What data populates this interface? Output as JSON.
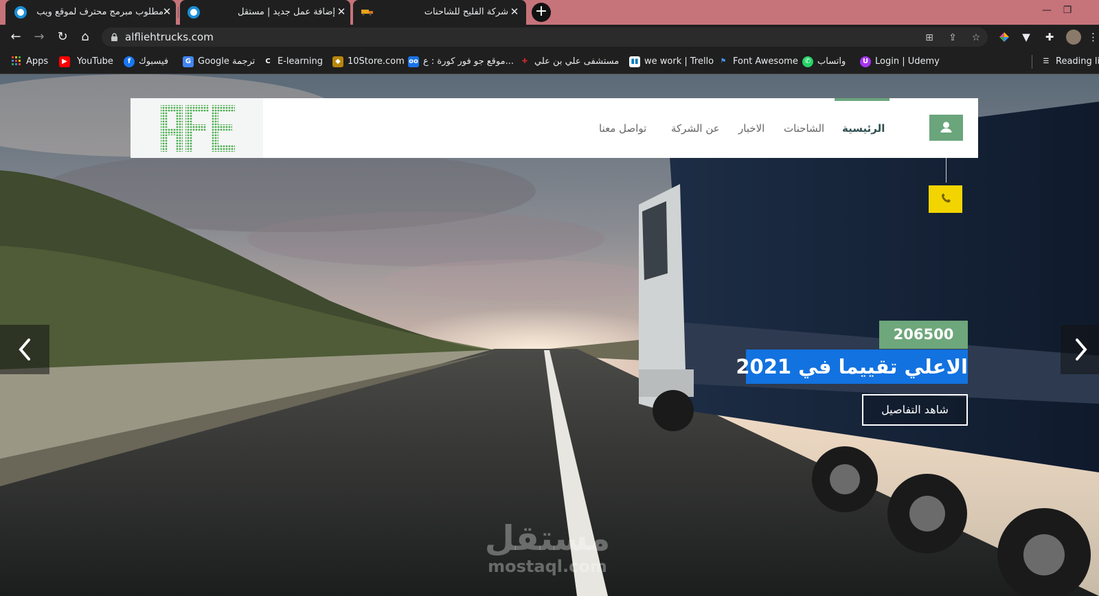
{
  "browser": {
    "tabs": [
      {
        "title": "مطلوب مبرمج محترف لموقع ويب |",
        "favicon": "ring-icon"
      },
      {
        "title": "إضافة عمل جديد | مستقل",
        "favicon": "ring-icon"
      },
      {
        "title": "شركة الفليح للشاحنات",
        "favicon": "truck-icon"
      }
    ],
    "new_tab_symbol": "+",
    "close_symbol": "✕",
    "url": "alfliehtrucks.com",
    "accent_color": "#c6737a"
  },
  "bookmarks": [
    {
      "label": "Apps",
      "icon": "apps-grid-icon"
    },
    {
      "label": "YouTube",
      "icon": "youtube-icon"
    },
    {
      "label": "فيسبوك",
      "icon": "facebook-icon"
    },
    {
      "label": "Google ترجمة",
      "icon": "google-translate-icon"
    },
    {
      "label": "E-learning",
      "icon": "c-icon"
    },
    {
      "label": "10Store.com",
      "icon": "store-icon"
    },
    {
      "label": "موقع جو فور كورة : ع...",
      "icon": "goal-icon"
    },
    {
      "label": "مستشفى علي بن علي",
      "icon": "hospital-icon"
    },
    {
      "label": "we work | Trello",
      "icon": "trello-icon"
    },
    {
      "label": "Font Awesome",
      "icon": "flag-icon"
    },
    {
      "label": "واتساب",
      "icon": "whatsapp-icon"
    },
    {
      "label": "Login | Udemy",
      "icon": "udemy-icon"
    },
    {
      "label": "Reading lis",
      "icon": "reading-list-icon"
    }
  ],
  "site": {
    "nav": [
      {
        "label": "الرئيسية",
        "active": true
      },
      {
        "label": "الشاحنات",
        "active": false
      },
      {
        "label": "الاخبار",
        "active": false
      },
      {
        "label": "عن الشركة",
        "active": false
      },
      {
        "label": "تواصل معنا",
        "active": false
      }
    ],
    "logo_text": "AFE",
    "brand_green": "#6aa57c",
    "phone_yellow": "#f2d500"
  },
  "hero": {
    "price": "206500 ر.س",
    "headline": "الاعلي تقييما في 2021",
    "details_button": "شاهد التفاصيل",
    "headline_bg": "#1272e0"
  },
  "watermark": {
    "arabic": "مستقل",
    "latin": "mostaql.com"
  }
}
